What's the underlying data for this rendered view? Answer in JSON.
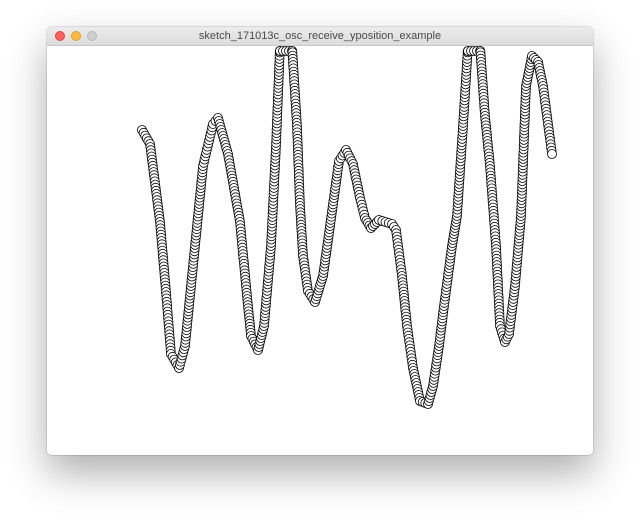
{
  "window": {
    "title": "sketch_171013c_osc_receive_yposition_example"
  },
  "controls": {
    "close_color": "#fc605c",
    "minimize_color": "#fdbc40",
    "maximize_color": "#cfcfcf"
  },
  "sketch": {
    "background": "#ffffff",
    "circle_fill": "#ffffff",
    "circle_stroke": "#000000"
  }
}
